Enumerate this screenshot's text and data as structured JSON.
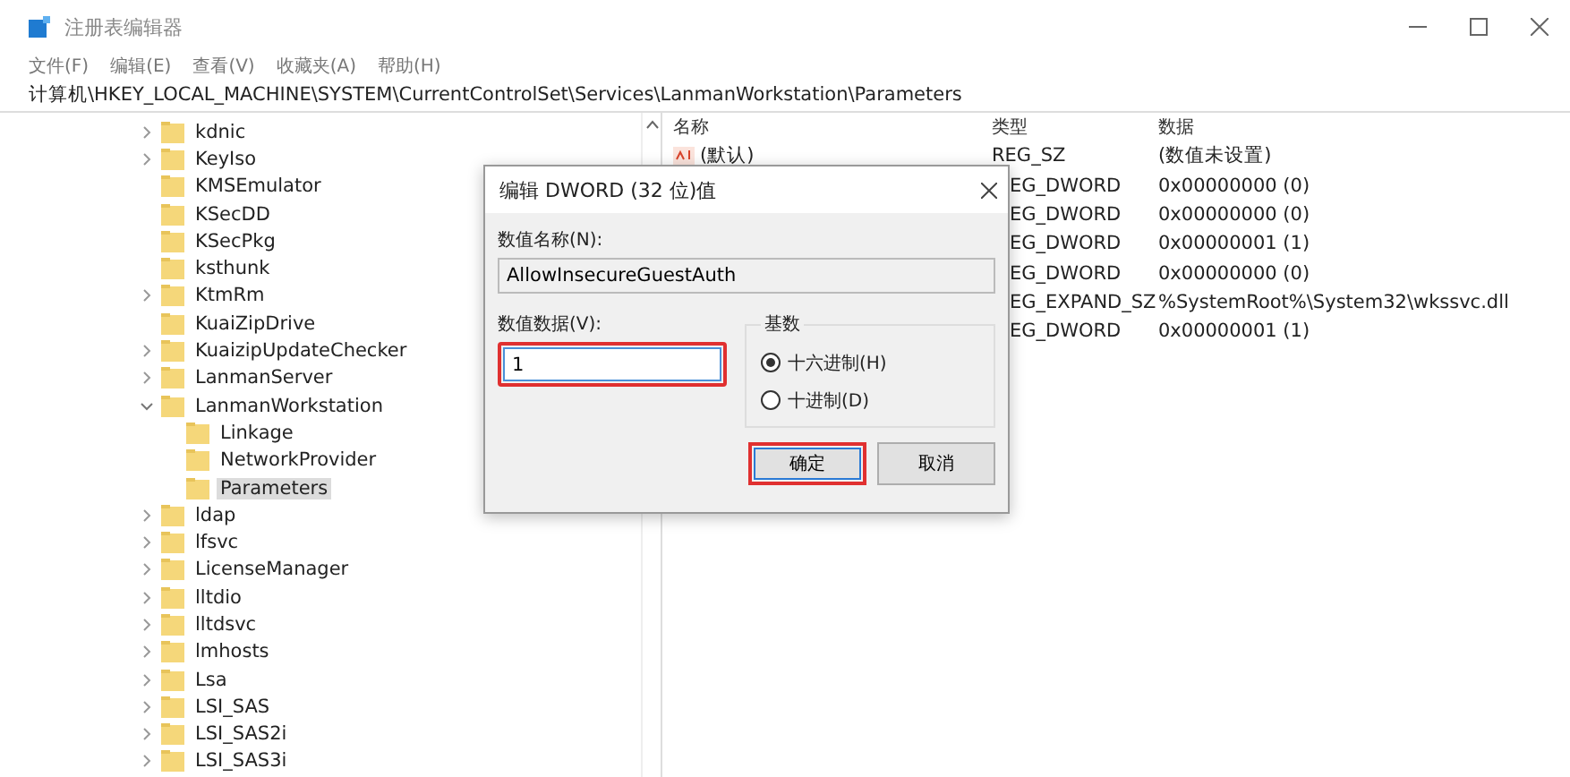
{
  "window": {
    "title": "注册表编辑器"
  },
  "menu": [
    "文件(F)",
    "编辑(E)",
    "查看(V)",
    "收藏夹(A)",
    "帮助(H)"
  ],
  "address": "计算机\\HKEY_LOCAL_MACHINE\\SYSTEM\\CurrentControlSet\\Services\\LanmanWorkstation\\Parameters",
  "tree": [
    {
      "label": "kdnic",
      "expandable": true,
      "expanded": false,
      "selected": false
    },
    {
      "label": "KeyIso",
      "expandable": true,
      "expanded": false,
      "selected": false
    },
    {
      "label": "KMSEmulator",
      "expandable": false,
      "selected": false
    },
    {
      "label": "KSecDD",
      "expandable": false,
      "selected": false
    },
    {
      "label": "KSecPkg",
      "expandable": false,
      "selected": false
    },
    {
      "label": "ksthunk",
      "expandable": false,
      "selected": false
    },
    {
      "label": "KtmRm",
      "expandable": true,
      "expanded": false,
      "selected": false
    },
    {
      "label": "KuaiZipDrive",
      "expandable": false,
      "selected": false
    },
    {
      "label": "KuaizipUpdateChecker",
      "expandable": true,
      "expanded": false,
      "selected": false
    },
    {
      "label": "LanmanServer",
      "expandable": true,
      "expanded": false,
      "selected": false
    },
    {
      "label": "LanmanWorkstation",
      "expandable": true,
      "expanded": true,
      "selected": false,
      "children": [
        {
          "label": "Linkage",
          "expandable": false,
          "selected": false
        },
        {
          "label": "NetworkProvider",
          "expandable": false,
          "selected": false
        },
        {
          "label": "Parameters",
          "expandable": false,
          "selected": true
        }
      ]
    },
    {
      "label": "ldap",
      "expandable": true,
      "expanded": false,
      "selected": false
    },
    {
      "label": "lfsvc",
      "expandable": true,
      "expanded": false,
      "selected": false
    },
    {
      "label": "LicenseManager",
      "expandable": true,
      "expanded": false,
      "selected": false
    },
    {
      "label": "lltdio",
      "expandable": true,
      "expanded": false,
      "selected": false
    },
    {
      "label": "lltdsvc",
      "expandable": true,
      "expanded": false,
      "selected": false
    },
    {
      "label": "lmhosts",
      "expandable": true,
      "expanded": false,
      "selected": false
    },
    {
      "label": "Lsa",
      "expandable": true,
      "expanded": false,
      "selected": false
    },
    {
      "label": "LSI_SAS",
      "expandable": true,
      "expanded": false,
      "selected": false
    },
    {
      "label": "LSI_SAS2i",
      "expandable": true,
      "expanded": false,
      "selected": false
    },
    {
      "label": "LSI_SAS3i",
      "expandable": true,
      "expanded": false,
      "selected": false
    }
  ],
  "values": {
    "columns": [
      "名称",
      "类型",
      "数据"
    ],
    "rows": [
      {
        "kind": "full",
        "name": "(默认)",
        "type": "REG_SZ",
        "data": "(数值未设置)"
      },
      {
        "kind": "covered",
        "type": "EG_DWORD",
        "data": "0x00000000 (0)"
      },
      {
        "kind": "covered",
        "type": "EG_DWORD",
        "data": "0x00000000 (0)"
      },
      {
        "kind": "covered",
        "type": "EG_DWORD",
        "data": "0x00000001 (1)"
      },
      {
        "kind": "covered",
        "type": "EG_DWORD",
        "data": "0x00000000 (0)"
      },
      {
        "kind": "covered",
        "type": "EG_EXPAND_SZ",
        "data": "%SystemRoot%\\System32\\wkssvc.dll"
      },
      {
        "kind": "covered",
        "type": "EG_DWORD",
        "data": "0x00000001 (1)"
      }
    ]
  },
  "dialog": {
    "title": "编辑 DWORD (32 位)值",
    "name_label": "数值名称(N):",
    "name_value": "AllowInsecureGuestAuth",
    "data_label": "数值数据(V):",
    "data_value": "1",
    "data_highlighted": true,
    "base_label": "基数",
    "base_options": [
      {
        "label": "十六进制(H)",
        "selected": true
      },
      {
        "label": "十进制(D)",
        "selected": false
      }
    ],
    "buttons": [
      {
        "label": "确定",
        "default": true,
        "highlighted": true
      },
      {
        "label": "取消",
        "default": false,
        "highlighted": false
      }
    ]
  }
}
